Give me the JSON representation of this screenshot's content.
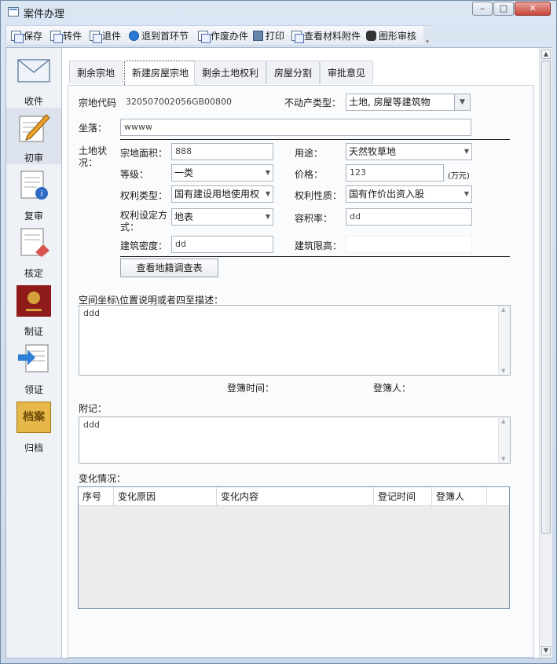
{
  "window": {
    "title": "案件办理"
  },
  "toolbar": {
    "items": [
      "保存",
      "转件",
      "退件",
      "退到首环节",
      "作废办件",
      "打印",
      "查看材料附件",
      "图形审核"
    ]
  },
  "sidebar": {
    "items": [
      "收件",
      "初审",
      "复审",
      "核定",
      "制证",
      "领证",
      "归档"
    ],
    "active": "初审",
    "archive_icon_text": "档案"
  },
  "tabs": [
    "剩余宗地",
    "新建房屋宗地",
    "剩余土地权利",
    "房屋分割",
    "审批意见"
  ],
  "active_tab": "新建房屋宗地",
  "form": {
    "parcel_code_label": "宗地代码",
    "parcel_code_value": "320507002056GB00800",
    "property_type_label": "不动产类型：",
    "property_type_value": "土地, 房屋等建筑物",
    "location_label": "坐落：",
    "location_value": "wwww",
    "land_status_label": "土地状况：",
    "area_label": "宗地面积：",
    "area_value": "888",
    "use_label": "用途：",
    "use_value": "天然牧草地",
    "grade_label": "等级：",
    "grade_value": "一类",
    "price_label": "价格：",
    "price_value": "123",
    "price_unit": "(万元)",
    "right_type_label": "权利类型：",
    "right_type_value": "国有建设用地使用权",
    "right_nature_label": "权利性质：",
    "right_nature_value": "国有作价出资入股",
    "right_setup_label": "权利设定方式：",
    "right_setup_value": "地表",
    "plot_ratio_label": "容积率：",
    "plot_ratio_value": "dd",
    "density_label": "建筑密度：",
    "density_value": "dd",
    "height_limit_label": "建筑限高：",
    "height_limit_value": "",
    "survey_button": "查看地籍调查表",
    "spatial_label": "空间坐标\\位置说明或者四至描述：",
    "spatial_value": "ddd",
    "register_time_label": "登簿时间：",
    "register_person_label": "登簿人：",
    "note_label": "附记：",
    "note_value": "ddd",
    "changes_label": "变化情况："
  },
  "changes_table": {
    "columns": [
      "序号",
      "变化原因",
      "变化内容",
      "登记时间",
      "登簿人"
    ]
  }
}
